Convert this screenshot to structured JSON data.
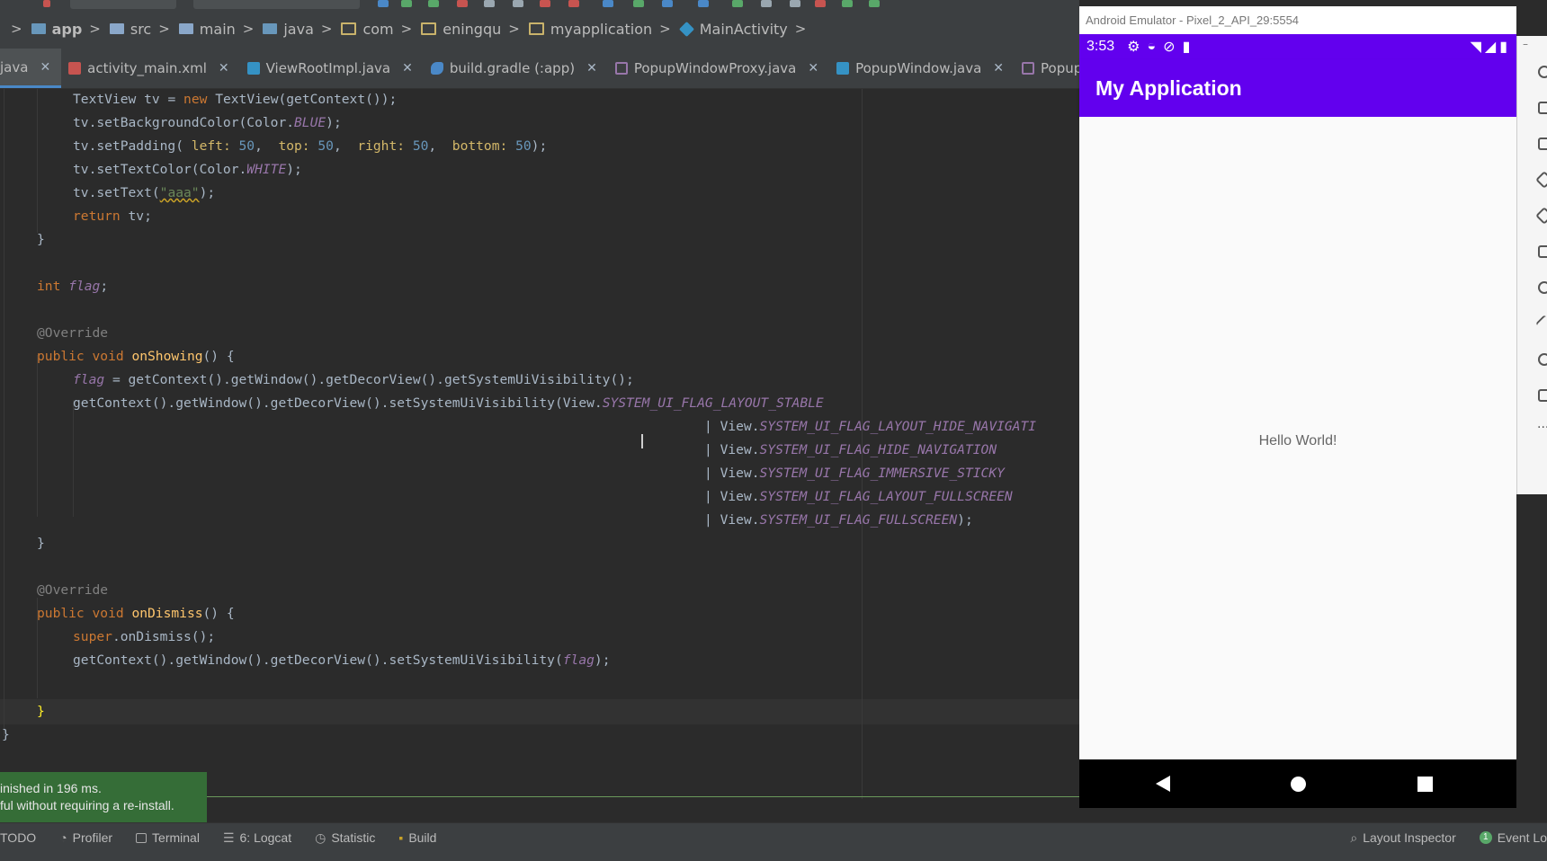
{
  "breadcrumb": [
    {
      "label": "app",
      "icon": "module-folder-icon"
    },
    {
      "label": "src",
      "icon": "folder-icon"
    },
    {
      "label": "main",
      "icon": "folder-icon"
    },
    {
      "label": "java",
      "icon": "source-folder-icon"
    },
    {
      "label": "com",
      "icon": "package-icon"
    },
    {
      "label": "eningqu",
      "icon": "package-icon"
    },
    {
      "label": "myapplication",
      "icon": "package-icon"
    },
    {
      "label": "MainActivity",
      "icon": "class-icon"
    }
  ],
  "tabs": [
    {
      "label": "java",
      "active": true
    },
    {
      "label": "activity_main.xml"
    },
    {
      "label": "ViewRootImpl.java"
    },
    {
      "label": "build.gradle (:app)"
    },
    {
      "label": "PopupWindowProxy.java"
    },
    {
      "label": "PopupWindow.java"
    },
    {
      "label": "PopupDecorViewProx"
    }
  ],
  "code": {
    "l1": {
      "pre": "TextView",
      "a": " tv ",
      "b": "= ",
      "kw": "new ",
      "c": "TextView(getContext());"
    },
    "l2": {
      "a": "tv.setBackgroundColor(Color.",
      "f": "BLUE",
      "b": ");"
    },
    "l3": {
      "a": "tv.setPadding( ",
      "h1": "left: ",
      "n1": "50",
      "c1": ",  ",
      "h2": "top: ",
      "n2": "50",
      "c2": ",  ",
      "h3": "right: ",
      "n3": "50",
      "c3": ",  ",
      "h4": "bottom: ",
      "n4": "50",
      "b": ");"
    },
    "l4": {
      "a": "tv.setTextColor(Color.",
      "f": "WHITE",
      "b": ");"
    },
    "l5": {
      "a": "tv.setText(",
      "s": "\"aaa\"",
      "b": ");"
    },
    "l6": {
      "kw": "return ",
      "a": "tv;"
    },
    "l7": "}",
    "l8": {
      "kw": "int ",
      "f": "flag",
      "b": ";"
    },
    "l9": "@Override",
    "l10": {
      "kw": "public void ",
      "m": "onShowing",
      "b": "() {"
    },
    "l11": {
      "f": "flag",
      "b": " = getContext().getWindow().getDecorView().getSystemUiVisibility();"
    },
    "l12": {
      "a": "getContext().getWindow().getDecorView().setSystemUiVisibility(View.",
      "f": "SYSTEM_UI_FLAG_LAYOUT_STABLE"
    },
    "l13": {
      "a": "| View.",
      "f": "SYSTEM_UI_FLAG_LAYOUT_HIDE_NAVIGATI"
    },
    "l14": {
      "a": "| View.",
      "f": "SYSTEM_UI_FLAG_HIDE_NAVIGATION"
    },
    "l15": {
      "a": "| View.",
      "f": "SYSTEM_UI_FLAG_IMMERSIVE_STICKY"
    },
    "l16": {
      "a": "| View.",
      "f": "SYSTEM_UI_FLAG_LAYOUT_FULLSCREEN"
    },
    "l17": {
      "a": "| View.",
      "f": "SYSTEM_UI_FLAG_FULLSCREEN",
      "b": ");"
    },
    "l18": "}",
    "l19": "@Override",
    "l20": {
      "kw": "public void ",
      "m": "onDismiss",
      "b": "() {"
    },
    "l21": {
      "kw": "super",
      "a": ".onDismiss();"
    },
    "l22": {
      "a": "getContext().getWindow().getDecorView().setSystemUiVisibility(",
      "f": "flag",
      "b": ");"
    },
    "l23": "}",
    "l24": "}"
  },
  "notification": {
    "line1": "inished in 196 ms.",
    "line2": "ful without requiring a re-install."
  },
  "toolwindows": [
    {
      "label": "TODO",
      "icon": "todo-icon"
    },
    {
      "label": "Profiler",
      "icon": "profiler-icon"
    },
    {
      "label": "Terminal",
      "icon": "terminal-icon"
    },
    {
      "label": "6: Logcat",
      "icon": "logcat-icon"
    },
    {
      "label": "Statistic",
      "icon": "statistic-icon"
    },
    {
      "label": "Build",
      "icon": "build-icon"
    }
  ],
  "toolwindows_right": [
    {
      "label": "Layout Inspector",
      "icon": "layout-inspector-icon"
    },
    {
      "label": "Event Lo",
      "icon": "event-log-icon",
      "badge": "1"
    }
  ],
  "emulator": {
    "title": "Android Emulator - Pixel_2_API_29:5554",
    "time": "3:53",
    "app_title": "My Application",
    "hello": "Hello World!"
  },
  "colors": {
    "accent_purple": "#6200ee",
    "editor_bg": "#2b2b2b",
    "notification_green": "#356d37"
  }
}
